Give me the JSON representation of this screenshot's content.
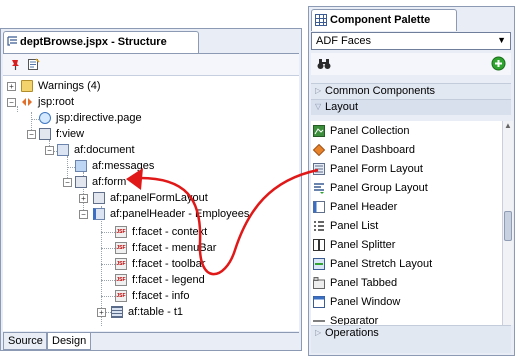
{
  "clipped_left_glyph": "t",
  "clipped_left_glyph_bottom": ".",
  "structure": {
    "title": "deptBrowse.jspx - Structure",
    "tree": [
      {
        "label": "Warnings (4)"
      },
      {
        "label": "jsp:root"
      },
      {
        "label": "jsp:directive.page"
      },
      {
        "label": "f:view"
      },
      {
        "label": "af:document"
      },
      {
        "label": "af:messages"
      },
      {
        "label": "af:form"
      },
      {
        "label": "af:panelFormLayout"
      },
      {
        "label": "af:panelHeader - Employees"
      },
      {
        "label": "f:facet - context"
      },
      {
        "label": "f:facet - menuBar"
      },
      {
        "label": "f:facet - toolbar"
      },
      {
        "label": "f:facet - legend"
      },
      {
        "label": "f:facet - info"
      },
      {
        "label": "af:table - t1"
      }
    ],
    "facet_badge": "JSF",
    "tabs": [
      {
        "label": "Source",
        "active": false
      },
      {
        "label": "Design",
        "active": true
      }
    ]
  },
  "palette": {
    "title": "Component Palette",
    "library": "ADF Faces",
    "sections": {
      "common": "Common Components",
      "layout": "Layout",
      "operations": "Operations"
    },
    "items": [
      {
        "label": "Panel Collection",
        "icon": "panel-collection-icon"
      },
      {
        "label": "Panel Dashboard",
        "icon": "panel-dashboard-icon"
      },
      {
        "label": "Panel Form Layout",
        "icon": "panel-form-layout-icon"
      },
      {
        "label": "Panel Group Layout",
        "icon": "panel-group-layout-icon"
      },
      {
        "label": "Panel Header",
        "icon": "panel-header-icon"
      },
      {
        "label": "Panel List",
        "icon": "panel-list-icon"
      },
      {
        "label": "Panel Splitter",
        "icon": "panel-splitter-icon"
      },
      {
        "label": "Panel Stretch Layout",
        "icon": "panel-stretch-layout-icon"
      },
      {
        "label": "Panel Tabbed",
        "icon": "panel-tabbed-icon"
      },
      {
        "label": "Panel Window",
        "icon": "panel-window-icon"
      },
      {
        "label": "Separator",
        "icon": "separator-icon"
      }
    ]
  },
  "colors": {
    "panel_bg": "#e9eef6",
    "border": "#8c9bb3",
    "drag_arrow": "#e01818"
  }
}
